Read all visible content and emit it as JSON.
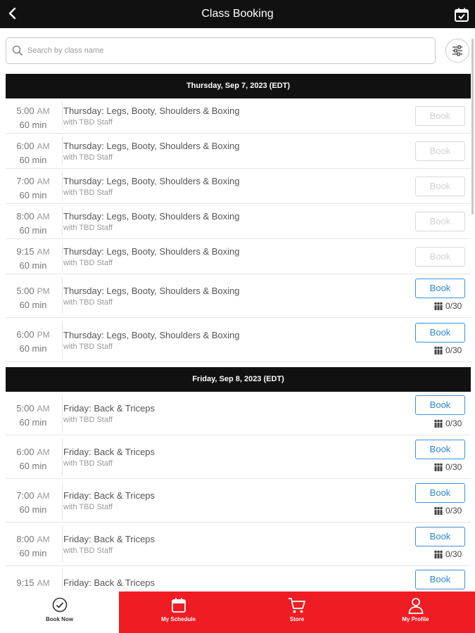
{
  "header": {
    "title": "Class Booking",
    "back_icon": "chevron-left-icon",
    "calendar_icon": "calendar-check-icon"
  },
  "search": {
    "placeholder": "Search by class name",
    "value": ""
  },
  "days": [
    {
      "header": "Thursday, Sep 7, 2023 (EDT)",
      "classes": [
        {
          "time": "5:00",
          "ampm": "AM",
          "duration": "60 min",
          "name": "Thursday: Legs, Booty, Shoulders & Boxing",
          "staff": "with TBD Staff",
          "book_label": "Book",
          "bookable": false,
          "capacity": ""
        },
        {
          "time": "6:00",
          "ampm": "AM",
          "duration": "60 min",
          "name": "Thursday: Legs, Booty, Shoulders & Boxing",
          "staff": "with TBD Staff",
          "book_label": "Book",
          "bookable": false,
          "capacity": ""
        },
        {
          "time": "7:00",
          "ampm": "AM",
          "duration": "60 min",
          "name": "Thursday: Legs, Booty, Shoulders & Boxing",
          "staff": "with TBD Staff",
          "book_label": "Book",
          "bookable": false,
          "capacity": ""
        },
        {
          "time": "8:00",
          "ampm": "AM",
          "duration": "60 min",
          "name": "Thursday: Legs, Booty, Shoulders & Boxing",
          "staff": "with TBD Staff",
          "book_label": "Book",
          "bookable": false,
          "capacity": ""
        },
        {
          "time": "9:15",
          "ampm": "AM",
          "duration": "60 min",
          "name": "Thursday: Legs, Booty, Shoulders & Boxing",
          "staff": "with TBD Staff",
          "book_label": "Book",
          "bookable": false,
          "capacity": ""
        },
        {
          "time": "5:00",
          "ampm": "PM",
          "duration": "60 min",
          "name": "Thursday: Legs, Booty, Shoulders & Boxing",
          "staff": "with TBD Staff",
          "book_label": "Book",
          "bookable": true,
          "capacity": "0/30"
        },
        {
          "time": "6:00",
          "ampm": "PM",
          "duration": "60 min",
          "name": "Thursday: Legs, Booty, Shoulders & Boxing",
          "staff": "with TBD Staff",
          "book_label": "Book",
          "bookable": true,
          "capacity": "0/30"
        }
      ]
    },
    {
      "header": "Friday, Sep 8, 2023 (EDT)",
      "classes": [
        {
          "time": "5:00",
          "ampm": "AM",
          "duration": "60 min",
          "name": "Friday: Back & Triceps",
          "staff": "with TBD Staff",
          "book_label": "Book",
          "bookable": true,
          "capacity": "0/30"
        },
        {
          "time": "6:00",
          "ampm": "AM",
          "duration": "60 min",
          "name": "Friday: Back & Triceps",
          "staff": "with TBD Staff",
          "book_label": "Book",
          "bookable": true,
          "capacity": "0/30"
        },
        {
          "time": "7:00",
          "ampm": "AM",
          "duration": "60 min",
          "name": "Friday: Back & Triceps",
          "staff": "with TBD Staff",
          "book_label": "Book",
          "bookable": true,
          "capacity": "0/30"
        },
        {
          "time": "8:00",
          "ampm": "AM",
          "duration": "60 min",
          "name": "Friday: Back & Triceps",
          "staff": "with TBD Staff",
          "book_label": "Book",
          "bookable": true,
          "capacity": "0/30"
        },
        {
          "time": "9:15",
          "ampm": "AM",
          "duration": "",
          "name": "Friday: Back & Triceps",
          "staff": "",
          "book_label": "Book",
          "bookable": true,
          "capacity": ""
        }
      ]
    }
  ],
  "nav": {
    "items": [
      {
        "label": "Book Now",
        "icon": "check-circle-icon"
      },
      {
        "label": "My Schedule",
        "icon": "calendar-icon"
      },
      {
        "label": "Store",
        "icon": "cart-icon"
      },
      {
        "label": "My Profile",
        "icon": "user-icon"
      }
    ]
  },
  "colors": {
    "header_bg": "#111111",
    "accent_red": "#ef1c24",
    "book_active": "#2f88d0",
    "book_disabled": "#d3d3d3"
  }
}
